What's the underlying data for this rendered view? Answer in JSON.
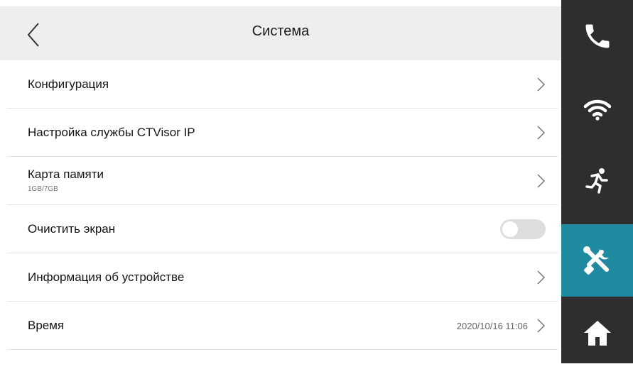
{
  "header": {
    "title": "Система"
  },
  "settings": {
    "items": [
      {
        "label": "Конфигурация"
      },
      {
        "label": "Настройка службы CTVisor IP"
      },
      {
        "label": "Карта памяти",
        "sublabel": "1GB/7GB"
      },
      {
        "label": "Очистить экран",
        "toggle_state": "off"
      },
      {
        "label": "Информация об устройстве"
      },
      {
        "label": "Время",
        "value": "2020/10/16 11:06"
      }
    ]
  },
  "sidebar": {
    "items": [
      {
        "icon": "phone-icon"
      },
      {
        "icon": "wifi-icon"
      },
      {
        "icon": "running-person-icon"
      },
      {
        "icon": "tools-icon",
        "active": true
      },
      {
        "icon": "home-icon"
      }
    ],
    "background_color": "#2e2e2e",
    "active_color": "#1f8aa0"
  }
}
